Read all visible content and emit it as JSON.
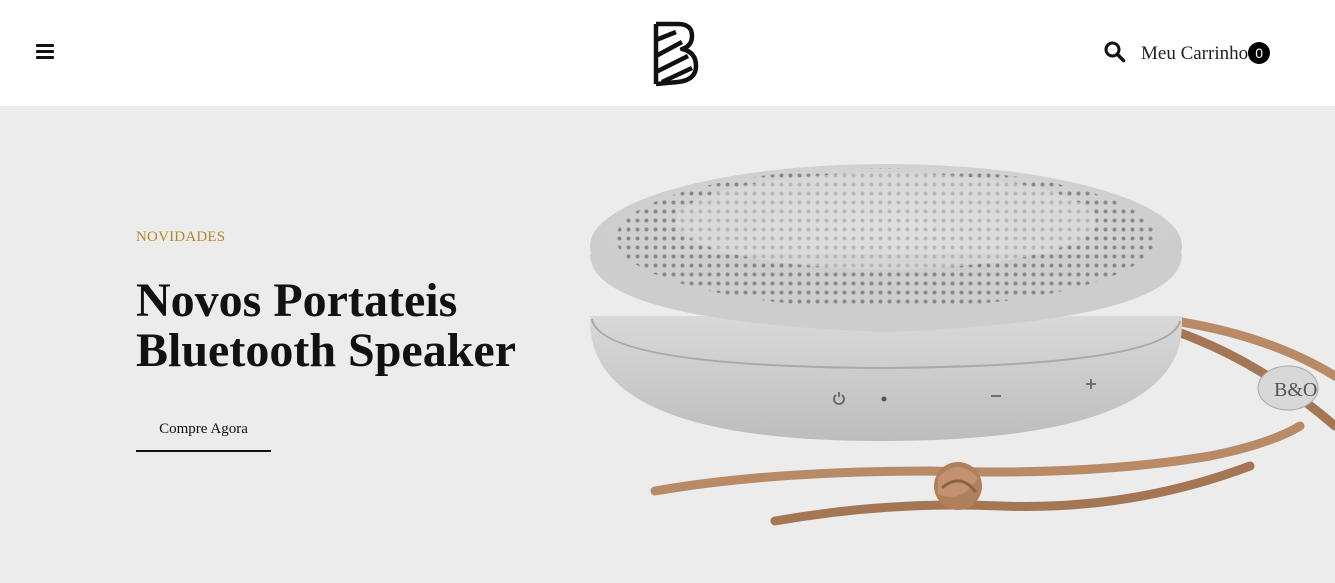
{
  "header": {
    "menu_icon": "hamburger-menu-icon",
    "logo_icon": "brand-b-logo-icon",
    "search_icon": "search-icon",
    "cart_label": "Meu Carrinho",
    "cart_count": "0"
  },
  "hero": {
    "eyebrow": "NOVIDADES",
    "title_line1": "Novos Portateis",
    "title_line2": "Bluetooth Speaker",
    "cta_label": "Compre Agora",
    "product_image": "bluetooth-speaker-with-leather-strap",
    "speaker_badge": "B&O",
    "colors": {
      "background": "#ececec",
      "eyebrow": "#b7882a",
      "speaker": "#d4d4d4",
      "strap": "#b88a66"
    }
  }
}
